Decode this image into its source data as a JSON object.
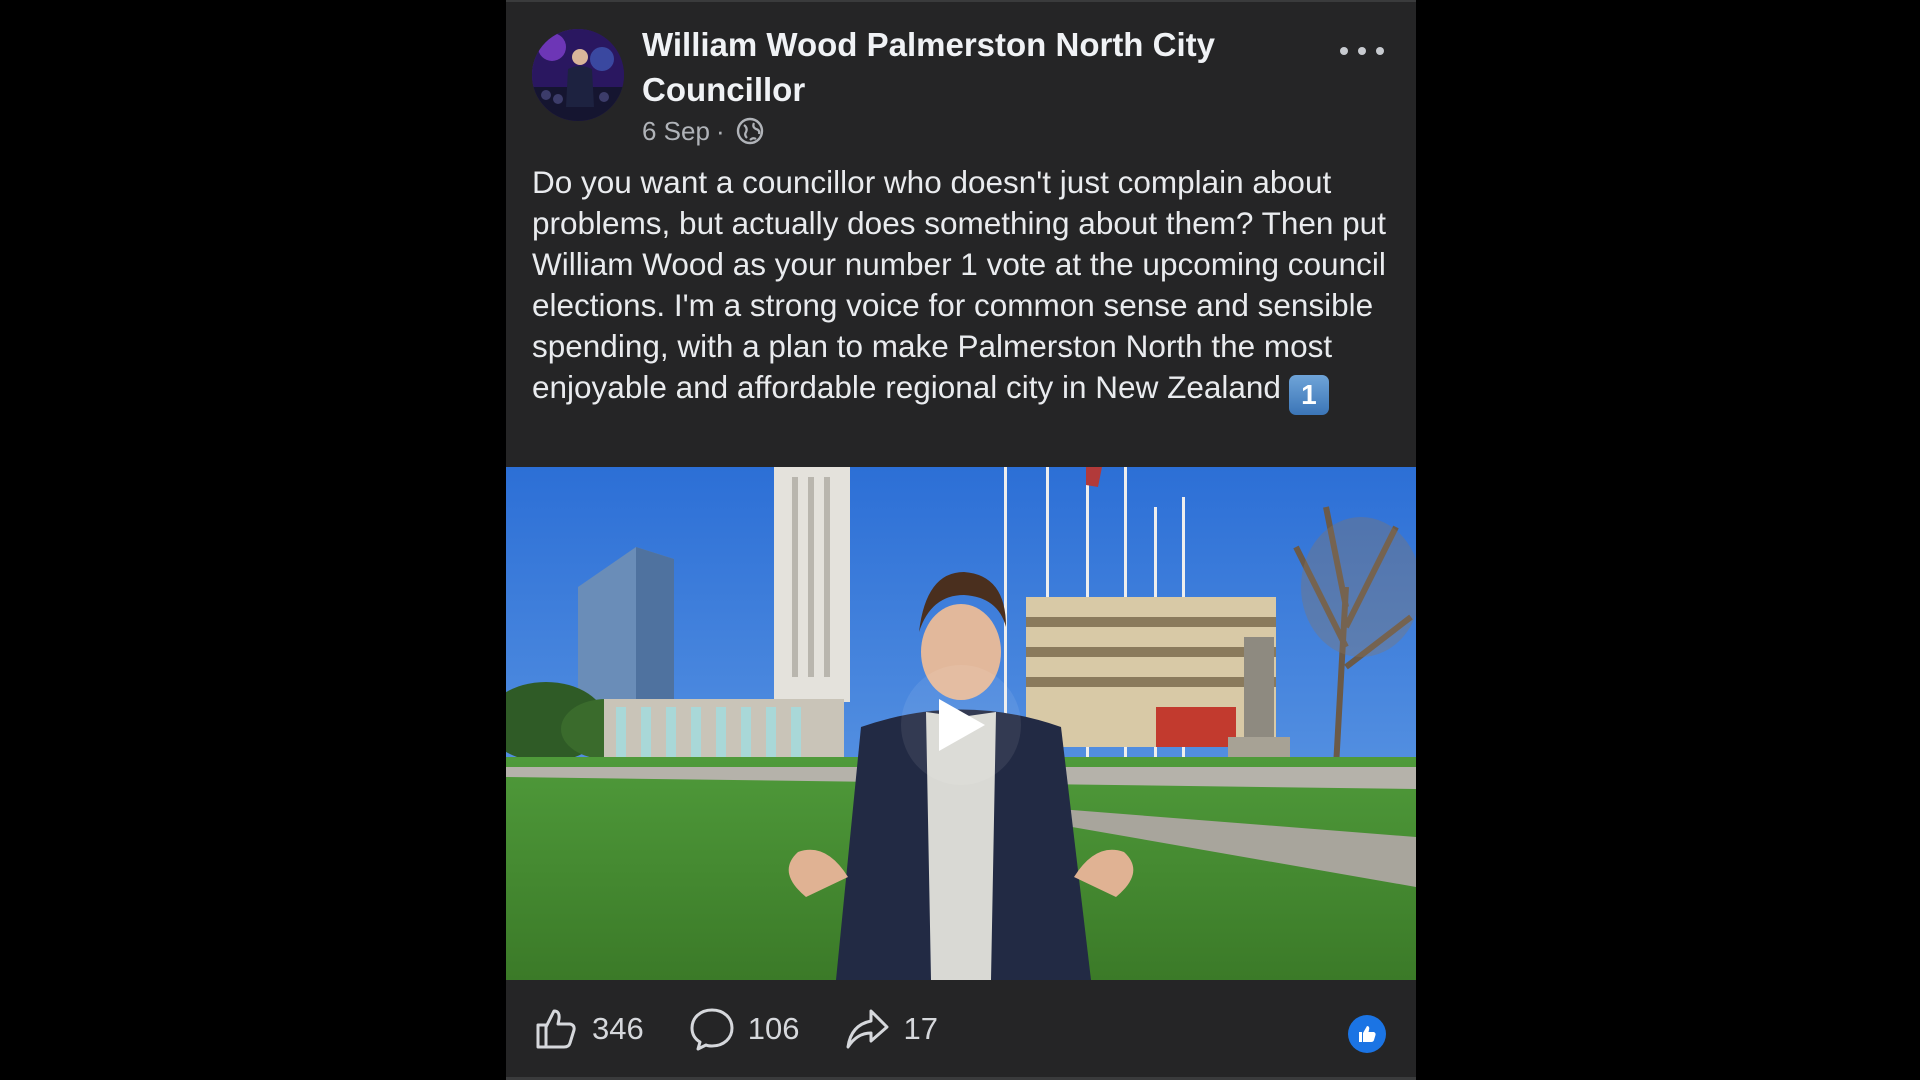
{
  "post": {
    "author": "William Wood Palmerston North City Councillor",
    "date": "6 Sep",
    "separator": "·",
    "audience_icon": "globe-icon",
    "more_icon": "more-options-icon",
    "message": "Do you want a councillor who doesn't just complain about problems, but actually does something about them? Then put William Wood as your number 1 vote at the upcoming council elections. I'm a strong voice for common sense and sensible spending, with a plan to make Palmerston North the most enjoyable and affordable regional city in New Zealand",
    "keycap": "1"
  },
  "video": {
    "play_icon": "play-icon"
  },
  "actions": {
    "like": {
      "icon": "thumbs-up-icon",
      "count": "346"
    },
    "comment": {
      "icon": "comment-bubble-icon",
      "count": "106"
    },
    "share": {
      "icon": "share-arrow-icon",
      "count": "17"
    }
  },
  "reaction": {
    "icon": "like-reaction-icon"
  },
  "colors": {
    "post_background": "#252526",
    "page_background": "#000000",
    "accent_blue": "#1b74e4",
    "text_primary": "#e4e6eb",
    "text_secondary": "#b0b3b8"
  }
}
